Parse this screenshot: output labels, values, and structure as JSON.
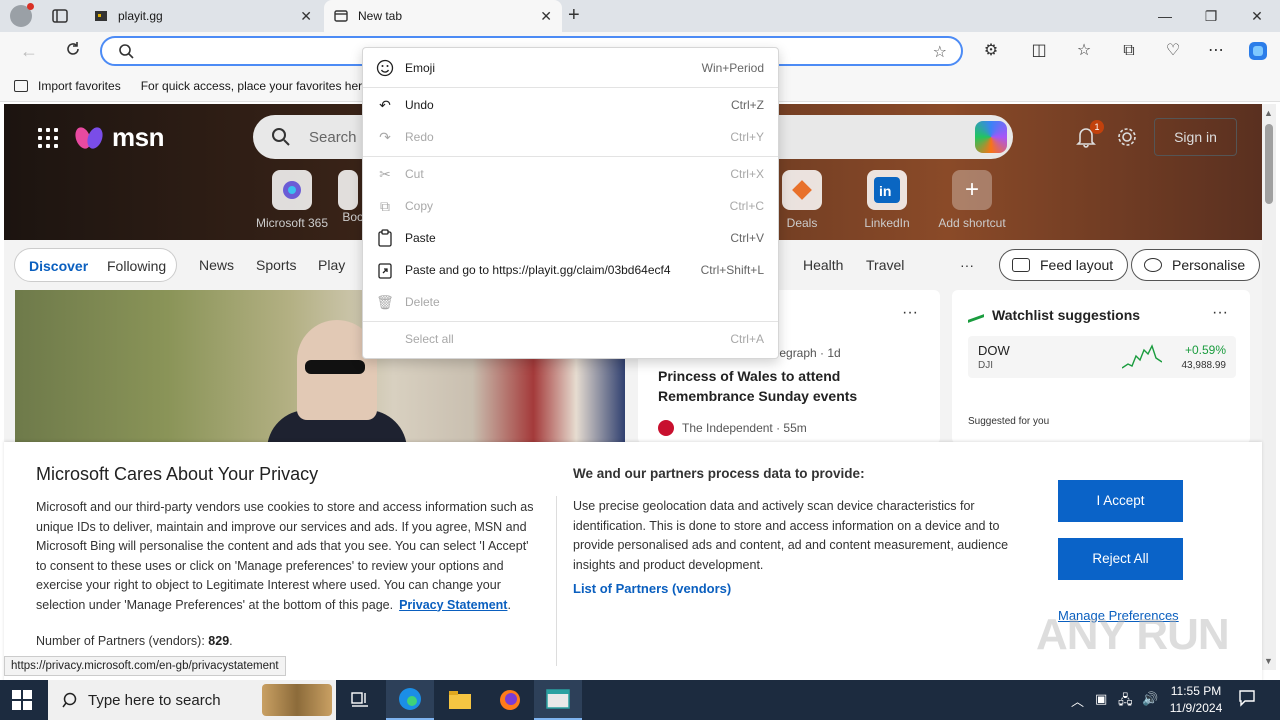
{
  "browser": {
    "tabs": [
      {
        "label": "playit.gg",
        "active": false
      },
      {
        "label": "New tab",
        "active": true
      }
    ],
    "address_value": "",
    "favorites_bar": {
      "import_label": "Import favorites",
      "hint": "For quick access, place your favorites here"
    }
  },
  "msn": {
    "logo_text": "msn",
    "search_placeholder": "Search",
    "notification_count": "1",
    "sign_in": "Sign in",
    "shortcuts": [
      "Microsoft 365",
      "Boo",
      "Deals",
      "LinkedIn",
      "Add shortcut"
    ],
    "nav": {
      "discover": "Discover",
      "following": "Following",
      "items": [
        "News",
        "Sports",
        "Play",
        "Health",
        "Travel"
      ],
      "feed_layout": "Feed layout",
      "personalise": "Personalise"
    },
    "news": {
      "source1": "elegraph · 1d",
      "headline": "Princess of Wales to attend Remembrance Sunday events",
      "source2": "The Independent · 55m"
    },
    "watchlist": {
      "title": "Watchlist suggestions",
      "stock_name": "DOW",
      "stock_exchange": "DJI",
      "stock_change": "+0.59%",
      "stock_value": "43,988.99",
      "suggested": "Suggested for you"
    }
  },
  "privacy": {
    "title": "Microsoft Cares About Your Privacy",
    "body": "Microsoft and our third-party vendors use cookies to store and access information such as unique IDs to deliver, maintain and improve our services and ads. If you agree, MSN and Microsoft Bing will personalise the content and ads that you see. You can select 'I Accept' to consent to these uses or click on 'Manage preferences' to review your options and exercise your right to object to Legitimate Interest where used.  You can change your selection under 'Manage Preferences' at the bottom of this page.",
    "privacy_link": "Privacy Statement",
    "partners_label": "Number of Partners (vendors):",
    "partners_count": "829",
    "right_title": "We and our partners process data to provide:",
    "right_body": "Use precise geolocation data and actively scan device characteristics for identification. This is done to store and access information on a device and to provide personalised ads and content, ad and content measurement, audience insights and product development.",
    "list_partners": "List of Partners (vendors)",
    "accept": "I Accept",
    "reject": "Reject All",
    "manage": "Manage Preferences"
  },
  "status_url": "https://privacy.microsoft.com/en-gb/privacystatement",
  "context_menu": {
    "items": [
      {
        "label": "Emoji",
        "shortcut": "Win+Period",
        "icon": "emoji-icon",
        "disabled": false
      },
      {
        "label": "Undo",
        "shortcut": "Ctrl+Z",
        "icon": "undo-icon",
        "disabled": false
      },
      {
        "label": "Redo",
        "shortcut": "Ctrl+Y",
        "icon": "redo-icon",
        "disabled": true
      },
      {
        "label": "Cut",
        "shortcut": "Ctrl+X",
        "icon": "cut-icon",
        "disabled": true
      },
      {
        "label": "Copy",
        "shortcut": "Ctrl+C",
        "icon": "copy-icon",
        "disabled": true
      },
      {
        "label": "Paste",
        "shortcut": "Ctrl+V",
        "icon": "paste-icon",
        "disabled": false
      },
      {
        "label": "Paste and go to https://playit.gg/claim/03bd64ecf4",
        "shortcut": "Ctrl+Shift+L",
        "icon": "paste-go-icon",
        "disabled": false
      },
      {
        "label": "Delete",
        "shortcut": "",
        "icon": "delete-icon",
        "disabled": true
      },
      {
        "label": "Select all",
        "shortcut": "Ctrl+A",
        "icon": "",
        "disabled": true
      }
    ]
  },
  "watermark": "ANY RUN",
  "taskbar": {
    "search_placeholder": "Type here to search",
    "time": "11:55 PM",
    "date": "11/9/2024"
  },
  "colors": {
    "accent": "#0a63c8",
    "address_border": "#4c8bf5",
    "taskbar": "#1c2b3f"
  }
}
